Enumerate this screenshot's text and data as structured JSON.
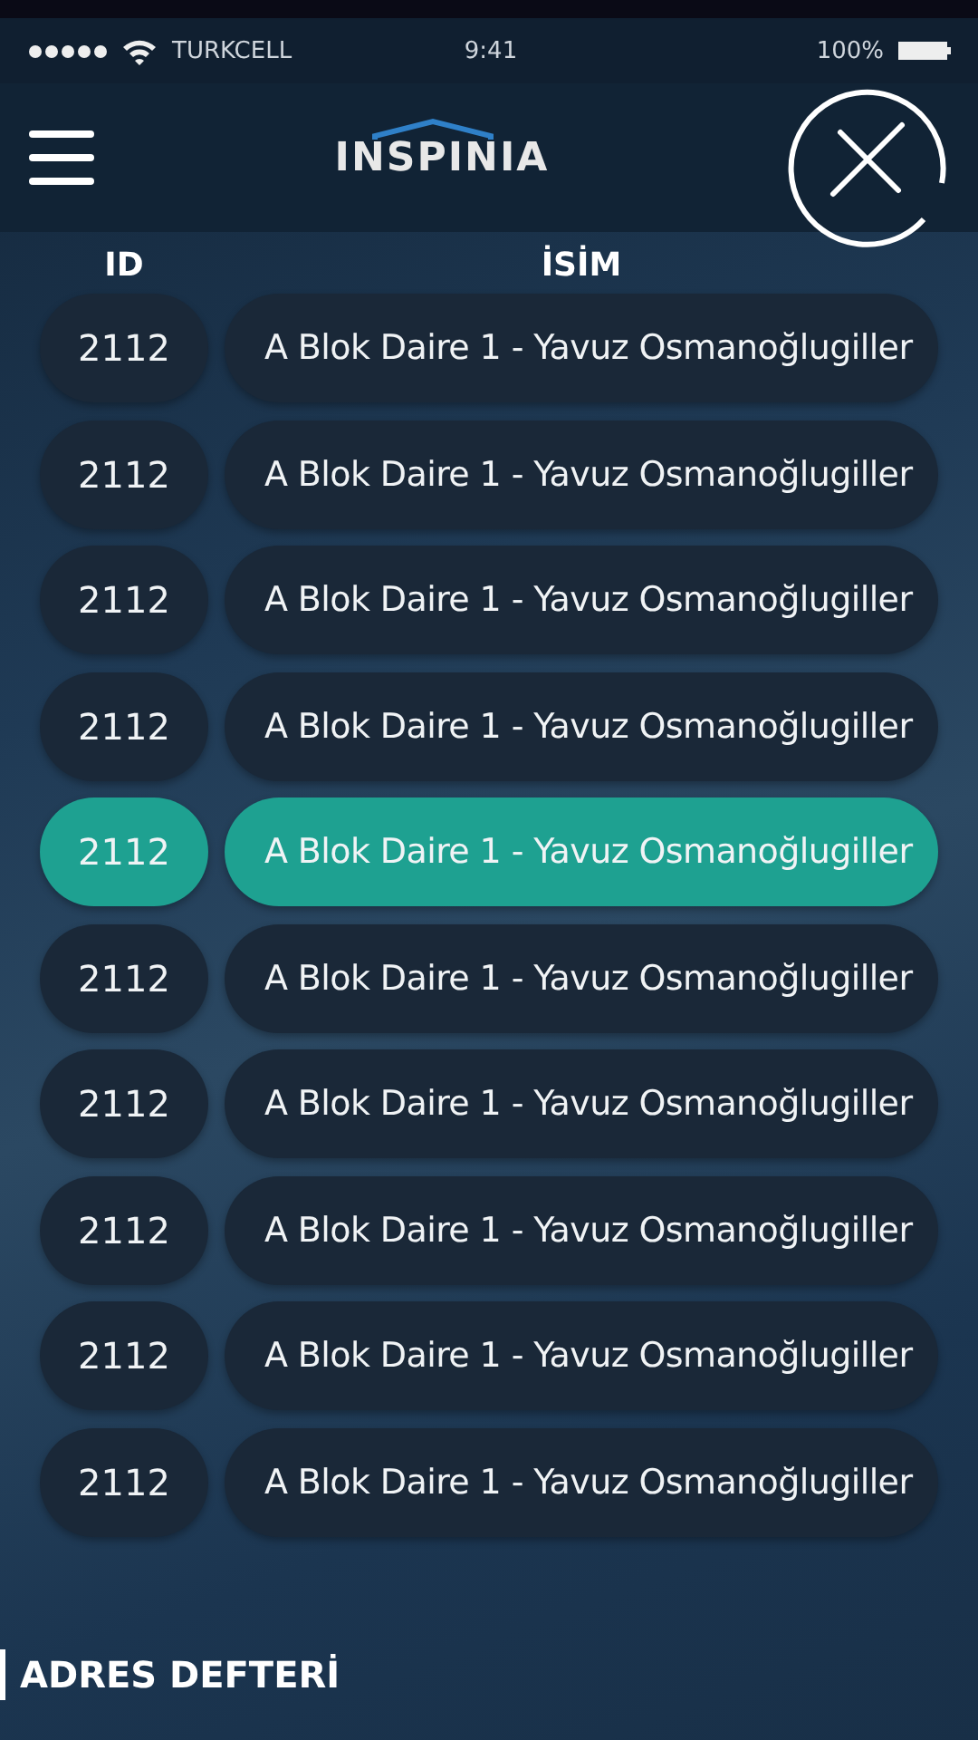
{
  "status_bar": {
    "carrier": "TURKCELL",
    "time": "9:41",
    "battery": "100%"
  },
  "header": {
    "logo": "INSPINIA"
  },
  "table": {
    "columns": [
      "ID",
      "İSİM"
    ],
    "rows": [
      {
        "id": "2112",
        "name": "A Blok Daire 1 - Yavuz Osmanoğlugiller",
        "selected": false
      },
      {
        "id": "2112",
        "name": "A Blok Daire 1 - Yavuz Osmanoğlugiller",
        "selected": false
      },
      {
        "id": "2112",
        "name": "A Blok Daire 1 - Yavuz Osmanoğlugiller",
        "selected": false
      },
      {
        "id": "2112",
        "name": "A Blok Daire 1 - Yavuz Osmanoğlugiller",
        "selected": false
      },
      {
        "id": "2112",
        "name": "A Blok Daire 1 - Yavuz Osmanoğlugiller",
        "selected": true
      },
      {
        "id": "2112",
        "name": "A Blok Daire 1 - Yavuz Osmanoğlugiller",
        "selected": false
      },
      {
        "id": "2112",
        "name": "A Blok Daire 1 - Yavuz Osmanoğlugiller",
        "selected": false
      },
      {
        "id": "2112",
        "name": "A Blok Daire 1 - Yavuz Osmanoğlugiller",
        "selected": false
      },
      {
        "id": "2112",
        "name": "A Blok Daire 1 - Yavuz Osmanoğlugiller",
        "selected": false
      },
      {
        "id": "2112",
        "name": "A Blok Daire 1 - Yavuz Osmanoğlugiller",
        "selected": false
      }
    ]
  },
  "footer": {
    "title": "ADRES DEFTERİ"
  }
}
